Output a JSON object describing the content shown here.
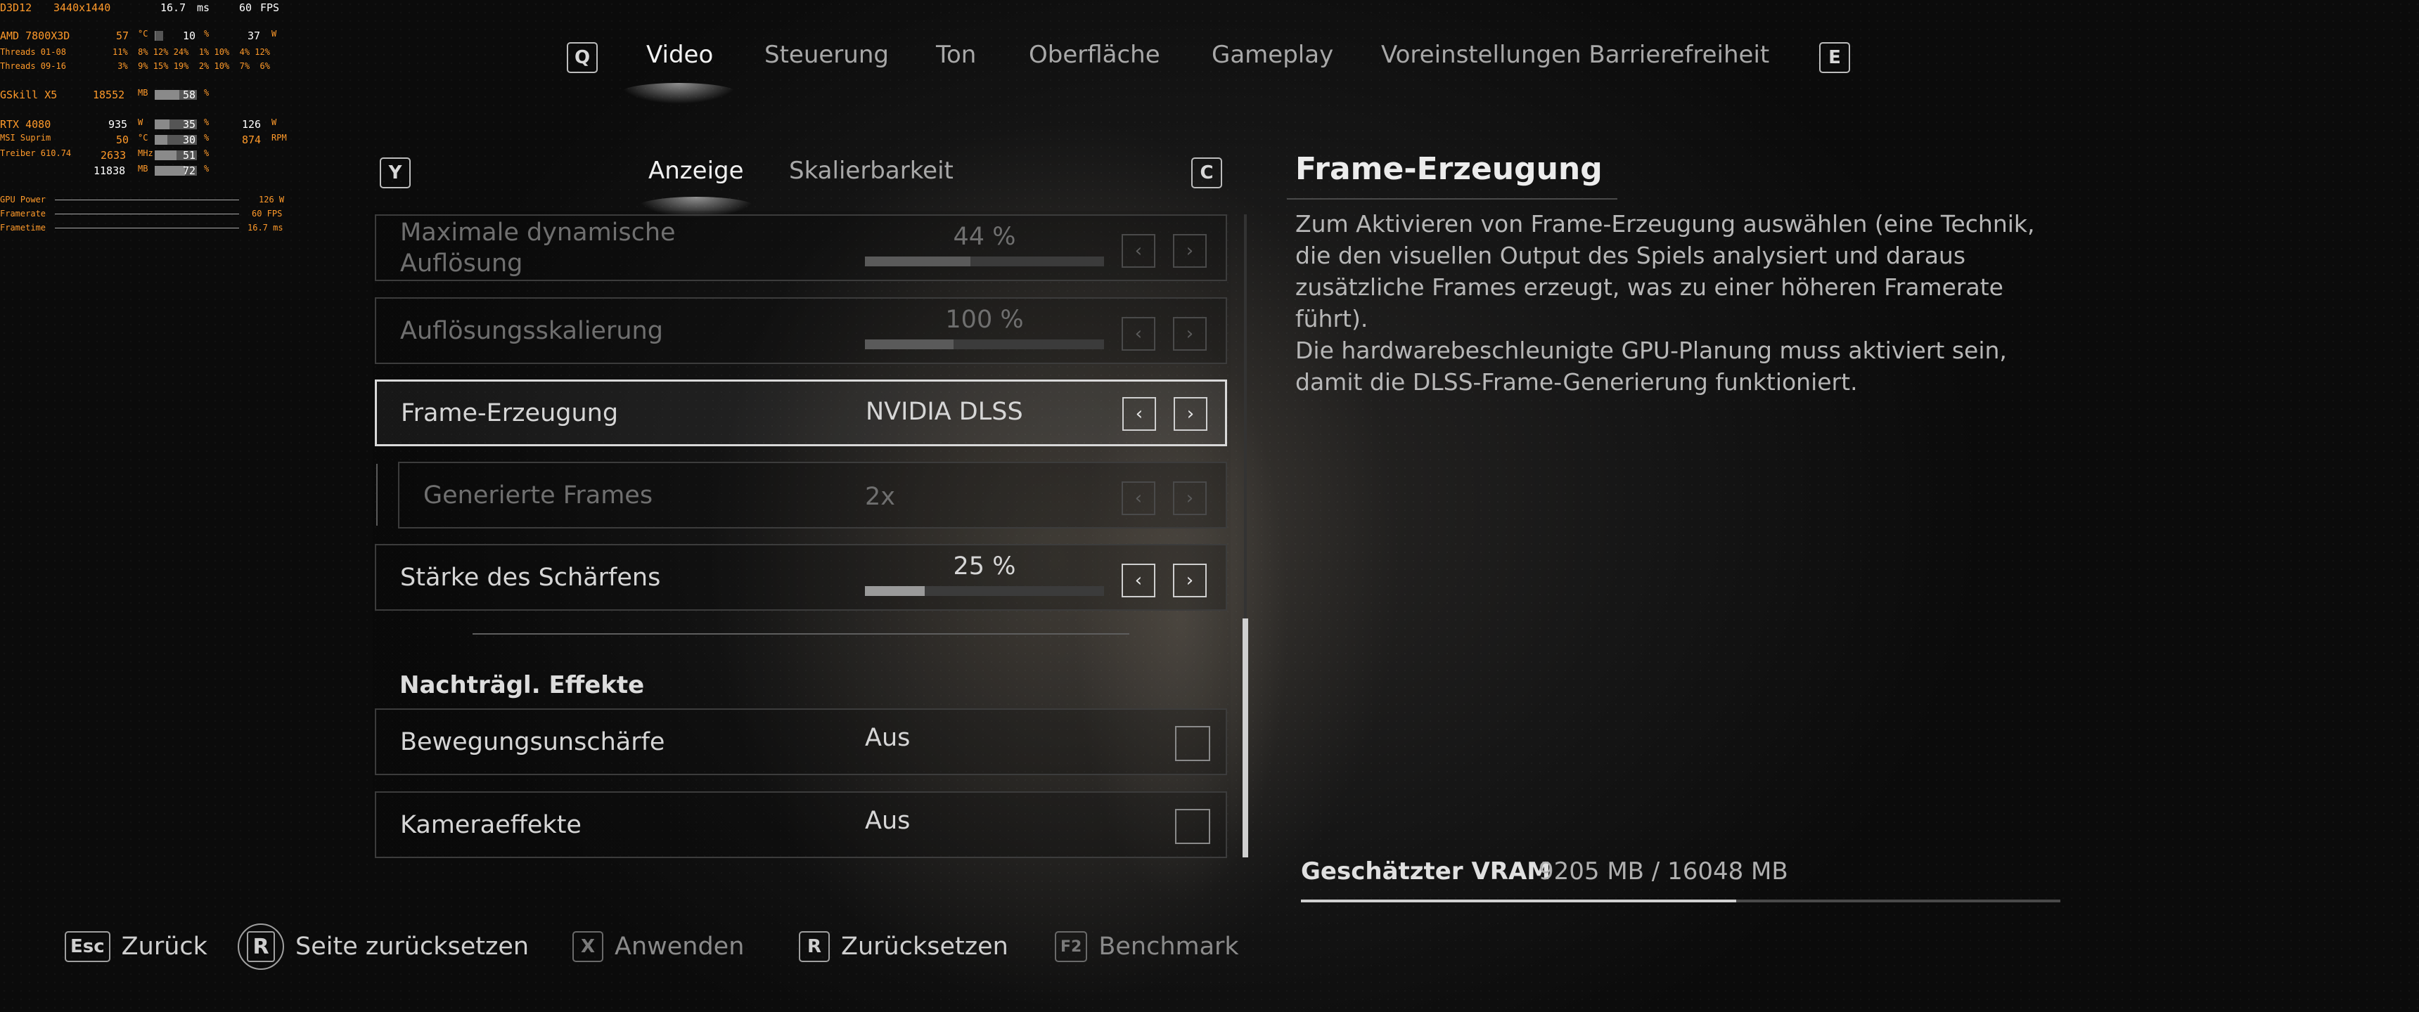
{
  "overlay": {
    "api": "D3D12",
    "resolution": "3440x1440",
    "frametime": "16.7",
    "frametime_unit": "ms",
    "fps": "60",
    "fps_unit": "FPS",
    "cpu_name": "AMD 7800X3D",
    "cpu_temp": "57",
    "cpu_temp_unit": "°C",
    "cpu_load": "10",
    "cpu_load_unit": "%",
    "cpu_power": "37",
    "cpu_power_unit": "W",
    "threads1_label": "Threads 01-08",
    "threads1_vals": "11%  8% 12% 24%  1% 10%  4% 12%",
    "threads2_label": "Threads 09-16",
    "threads2_vals": " 3%  9% 15% 19%  2% 10%  7%  6%",
    "ram_name": "GSkill X5",
    "ram_used": "18552",
    "ram_used_unit": "MB",
    "ram_load": "58",
    "ram_load_unit": "%",
    "gpu_name": "RTX 4080",
    "gpu_sub": "MSI Suprim",
    "gpu_driver": "Treiber 610.74",
    "gpu_power": "935",
    "gpu_power_unit": "W",
    "gpu_load": "35",
    "gpu_load_unit": "%",
    "gpu_watts": "126",
    "gpu_watts_unit": "W",
    "gpu_temp": "50",
    "gpu_temp_unit": "°C",
    "gpu_temp_load": "30",
    "gpu_fan": "874",
    "gpu_fan_unit": "RPM",
    "gpu_clock": "2633",
    "gpu_clock_unit": "MHz",
    "gpu_clock_load": "51",
    "gpu_vram": "11838",
    "gpu_vram_unit": "MB",
    "gpu_vram_load": "72",
    "graph1_label": "GPU Power",
    "graph1_value": "126 W",
    "graph2_label": "Framerate",
    "graph2_value": "60 FPS",
    "graph3_label": "Frametime",
    "graph3_value": "16.7 ms",
    "bar_levels": {
      "cpu_load": 0.1,
      "ram_load": 0.58,
      "gpu_load": 0.35,
      "gpu_temp_load": 0.3,
      "gpu_clock_load": 0.51,
      "gpu_vram_load": 0.72
    }
  },
  "top_nav": {
    "left_key": "Q",
    "right_key": "E",
    "tabs": [
      "Video",
      "Steuerung",
      "Ton",
      "Oberfläche",
      "Gameplay",
      "Voreinstellungen Barrierefreiheit"
    ],
    "active": "Video"
  },
  "sub_nav": {
    "left_key": "Y",
    "right_key": "C",
    "tabs": [
      "Anzeige",
      "Skalierbarkeit"
    ],
    "active": "Anzeige"
  },
  "settings": {
    "rows": [
      {
        "label": "Maximale dynamische Auflösung",
        "value": "44 %",
        "level": 0.44,
        "state": "disabled"
      },
      {
        "label": "Auflösungsskalierung",
        "value": "100 %",
        "level": 0.37,
        "state": "disabled"
      },
      {
        "label": "Frame-Erzeugung",
        "value": "NVIDIA DLSS",
        "state": "selected"
      },
      {
        "label": "Generierte Frames",
        "value": "2x",
        "state": "disabled"
      },
      {
        "label": "Stärke des Schärfens",
        "value": "25 %",
        "level": 0.25,
        "state": "normal"
      }
    ],
    "section_title": "Nachträgl. Effekte",
    "toggles": [
      {
        "label": "Bewegungsunschärfe",
        "value": "Aus"
      },
      {
        "label": "Kameraeffekte",
        "value": "Aus"
      }
    ],
    "arrow_left": "‹",
    "arrow_right": "›"
  },
  "description": {
    "title": "Frame-Erzeugung",
    "paragraph1": "Zum Aktivieren von Frame-Erzeugung auswählen (eine Technik, die den visuellen Output des Spiels analysiert und daraus zusätzliche Frames erzeugt, was zu einer höheren Framerate führt).",
    "paragraph2": "Die hardwarebeschleunigte GPU-Planung muss aktiviert sein, damit die DLSS-Frame-Generierung funktioniert."
  },
  "vram": {
    "label": "Geschätzter VRAM",
    "value": "9205 MB / 16048 MB",
    "fraction": 0.5736
  },
  "footer": [
    {
      "key": "Esc",
      "label": "Zurück",
      "style": "normal"
    },
    {
      "key": "R",
      "label": "Seite zurücksetzen",
      "style": "round"
    },
    {
      "key": "X",
      "label": "Anwenden",
      "style": "dim"
    },
    {
      "key": "R",
      "label": "Zurücksetzen",
      "style": "normal"
    },
    {
      "key": "F2",
      "label": "Benchmark",
      "style": "dim"
    }
  ],
  "colors": {
    "overlay_text": "#ff9a2a",
    "accent": "#d9d9d9",
    "background": "#141414"
  }
}
